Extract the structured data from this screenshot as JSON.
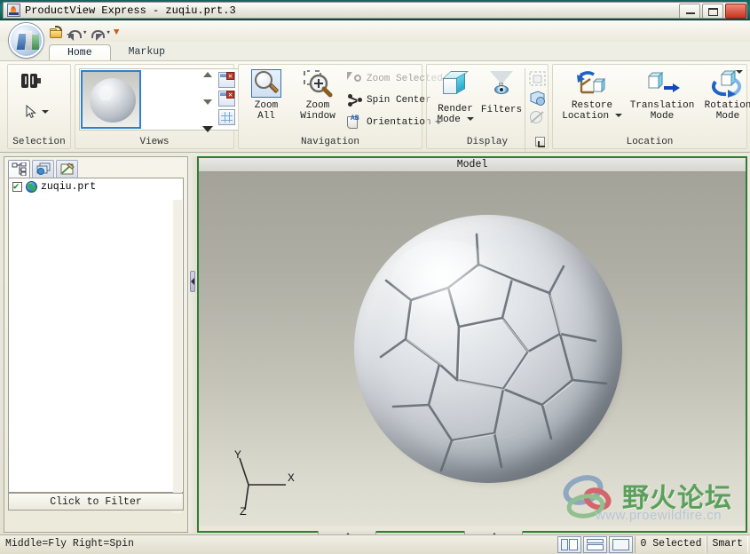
{
  "window": {
    "title": "ProductView Express - zuqiu.prt.3",
    "app_icon": "app-icon",
    "controls": {
      "minimize": "minimize",
      "restore": "restore",
      "close": "close"
    }
  },
  "quick_access": {
    "items": [
      {
        "name": "open",
        "icon": "open-folder-icon"
      },
      {
        "name": "undo",
        "icon": "undo-icon",
        "has_dropdown": true
      },
      {
        "name": "redo",
        "icon": "redo-icon",
        "has_dropdown": true
      },
      {
        "name": "customize",
        "icon": "customize-qat-icon"
      }
    ]
  },
  "ribbon": {
    "tabs": [
      {
        "label": "Home",
        "active": true
      },
      {
        "label": "Markup",
        "active": false
      }
    ],
    "groups": {
      "selection": {
        "title": "Selection",
        "buttons": [
          {
            "label": "",
            "icon": "binoculars-icon"
          },
          {
            "label": "",
            "icon": "select-cursor-icon",
            "has_dropdown": true
          }
        ]
      },
      "views": {
        "title": "Views",
        "thumbnail_alt": "soccer-ball-view-thumbnail",
        "scroll": [
          "scroll-up",
          "scroll-down",
          "more-views"
        ],
        "gallery_buttons": [
          "save-view",
          "manage-views",
          "view-grid"
        ]
      },
      "navigation": {
        "title": "Navigation",
        "zoom_all": "Zoom\nAll",
        "zoom_all_line1": "Zoom",
        "zoom_all_line2": "All",
        "zoom_window_line1": "Zoom",
        "zoom_window_line2": "Window",
        "zoom_selected": "Zoom Selected",
        "spin_center": "Spin Center",
        "orientation": "Orientation"
      },
      "display": {
        "title": "Display",
        "render_mode_line1": "Render",
        "render_mode_line2": "Mode",
        "filters": "Filters",
        "small_buttons": [
          "transparency-icon",
          "clip-plane-icon",
          "hidden-line-icon"
        ],
        "dialog_launcher": "display-dialog-launcher"
      },
      "location": {
        "title": "Location",
        "restore_location_line1": "Restore",
        "restore_location_line2": "Location",
        "translation_mode_line1": "Translation",
        "translation_mode_line2": "Mode",
        "rotation_mode_line1": "Rotation",
        "rotation_mode_line2": "Mode",
        "more": "location-group-more"
      }
    }
  },
  "left_panel": {
    "tabs": [
      {
        "name": "structure-tree-tab",
        "active": true
      },
      {
        "name": "layers-tab",
        "active": false
      },
      {
        "name": "markup-tab",
        "active": false
      }
    ],
    "tree": [
      {
        "label": "zuqiu.prt",
        "checked": true,
        "icon": "part-globe-icon"
      }
    ],
    "filter_label": "Click to Filter"
  },
  "viewport": {
    "title": "Model",
    "model_name": "soccer-ball-model",
    "axes": {
      "x": "X",
      "y": "Y",
      "z": "Z"
    },
    "border_color": "#2e7d32",
    "background_top": "#a3a39a",
    "background_bottom": "#e2e1d6"
  },
  "watermark": {
    "text": "野火论坛",
    "url": "www.proewildfire.cn",
    "text_color": "#5aa05a"
  },
  "status_bar": {
    "hints": "Middle=Fly   Right=Spin",
    "selected": "0 Selected",
    "mode": "Smart",
    "panel_buttons": [
      "toggle-left-panel",
      "toggle-bottom-panel",
      "toggle-right-panel"
    ]
  }
}
